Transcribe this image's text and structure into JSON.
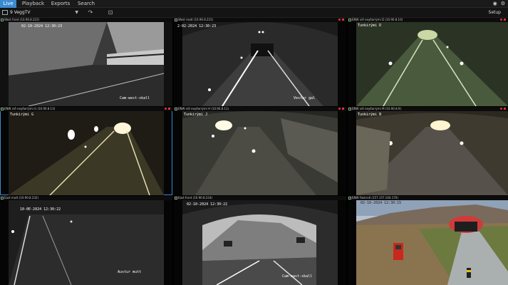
{
  "tabs": {
    "live": "Live",
    "playback": "Playback",
    "exports": "Exports",
    "search": "Search"
  },
  "toolbar": {
    "view_name": "9 VeggTV",
    "setup": "Setup"
  },
  "cameras": [
    {
      "name": "West front (10.90.8.222)",
      "osd_time": "02-10-2024 12:30:23",
      "osd_label": "Cam-west-skall"
    },
    {
      "name": "West mutt (10.90.8.221)",
      "osd_time": "2-02-2024 12:30:23",
      "osd_label": "Vestur gal"
    },
    {
      "name": "ENW við neyðarrými D (10.90.8.10)",
      "osd_time": "",
      "osd_label": "Tunkirými D"
    },
    {
      "name": "ENW við neyðarrými G (10.90.8.13)",
      "osd_time": "",
      "osd_label": "Tunkirými G"
    },
    {
      "name": "ENW við neyðarrými H (10.90.8.11)",
      "osd_time": "",
      "osd_label": "Tunkirými J"
    },
    {
      "name": "ENW við neyðarrými M (10.90.8.9)",
      "osd_time": "",
      "osd_label": "Tunkirými B"
    },
    {
      "name": "East mutt (10.90.8.232)",
      "osd_time": "10-0E-2024 12:30:22",
      "osd_label": "Austur mutt"
    },
    {
      "name": "East front (10.90.8.224)",
      "osd_time": "02-10-2024 12:30:22",
      "osd_label": "Cam-east-skall"
    },
    {
      "name": "ENW Fáskrúð (157.157.104.170)",
      "osd_time": "02-10-2024 12:30:15",
      "osd_label": ""
    }
  ],
  "colors": {
    "accent": "#3b8bd0",
    "recording": "#d33333"
  }
}
